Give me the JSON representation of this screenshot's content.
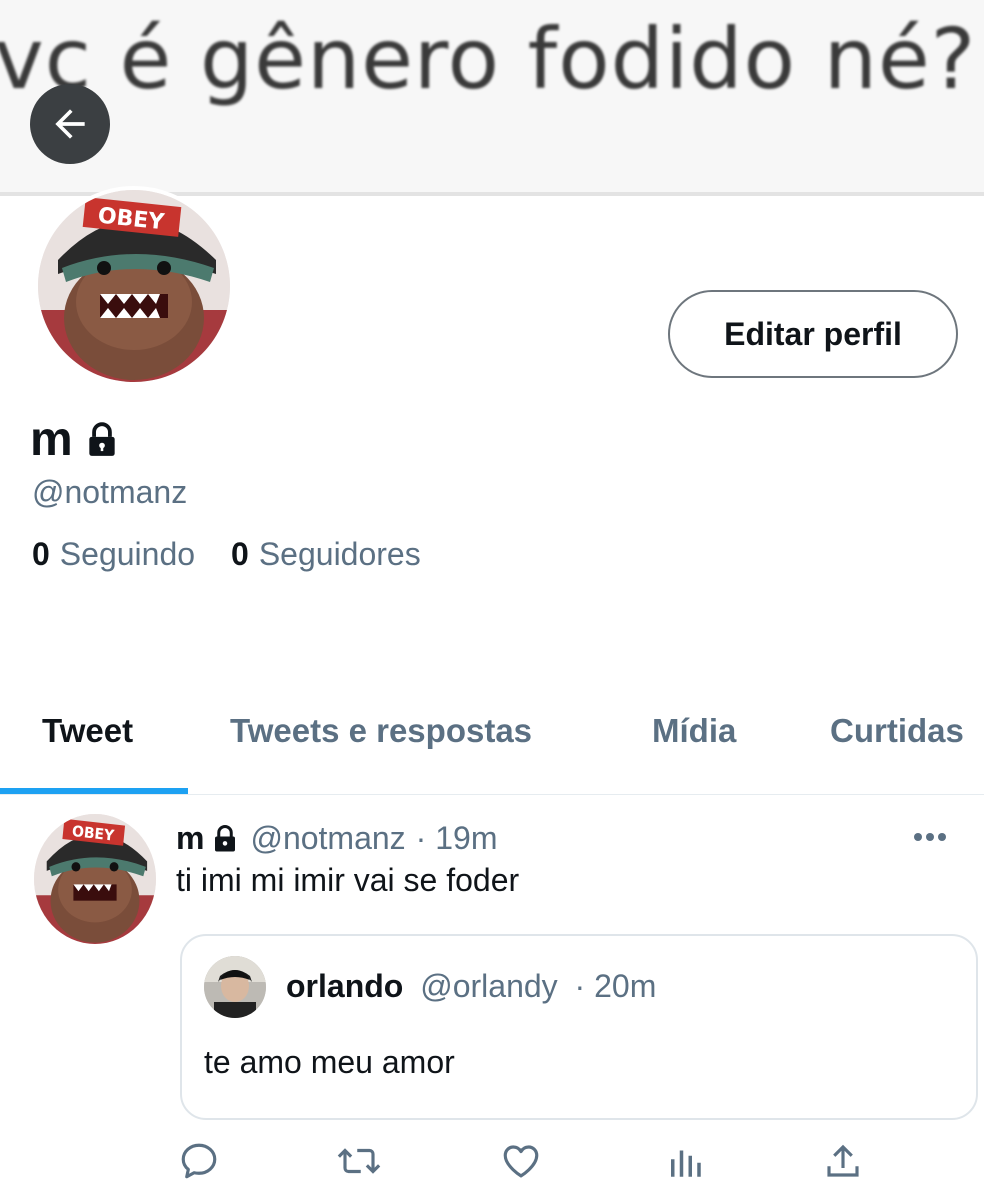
{
  "banner": {
    "text": "vc é gênero fodido né?"
  },
  "header": {
    "back_icon": "arrow-left-icon"
  },
  "profile": {
    "edit_label": "Editar perfil",
    "display_name": "m",
    "handle": "@notmanz",
    "following_count": "0",
    "following_label": "Seguindo",
    "followers_count": "0",
    "followers_label": "Seguidores"
  },
  "tabs": [
    {
      "label": "Tweet",
      "active": true
    },
    {
      "label": "Tweets e respostas"
    },
    {
      "label": "Mídia"
    },
    {
      "label": "Curtidas"
    }
  ],
  "tweet": {
    "name": "m",
    "handle": "@notmanz",
    "time": "· 19m",
    "text": "ti imi mi imir vai se foder",
    "quote": {
      "name": "orlando",
      "handle": "@orlandy",
      "time": "· 20m",
      "text": "te amo meu amor"
    },
    "actions": [
      "reply-icon",
      "retweet-icon",
      "like-icon",
      "analytics-icon",
      "share-icon"
    ]
  },
  "colors": {
    "accent": "#1da1f2",
    "muted": "#5b7083",
    "text": "#0f1419"
  }
}
